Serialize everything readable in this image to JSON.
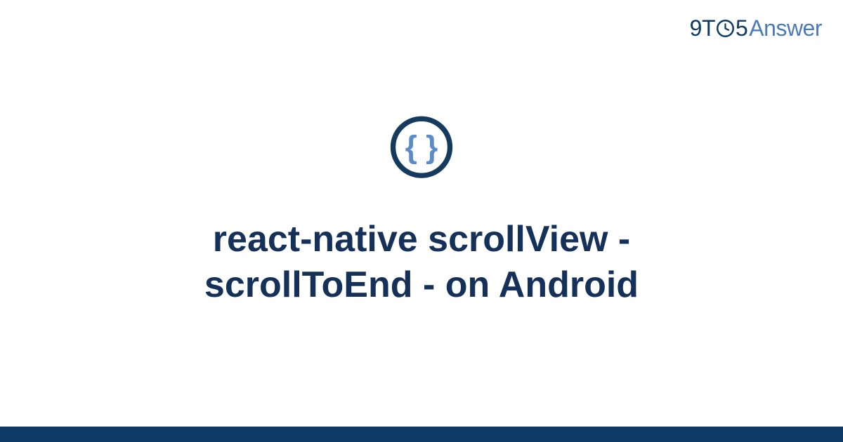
{
  "logo": {
    "part1": "9T",
    "part2": "5",
    "part3": "Answer"
  },
  "icon": {
    "name": "braces"
  },
  "title": "react-native scrollView - scrollToEnd - on Android",
  "colors": {
    "dark_blue": "#0d3b66",
    "mid_blue": "#4a7bb7",
    "title_blue": "#15315a",
    "icon_ring": "#143a5e",
    "icon_brace": "#5b8bc9"
  }
}
